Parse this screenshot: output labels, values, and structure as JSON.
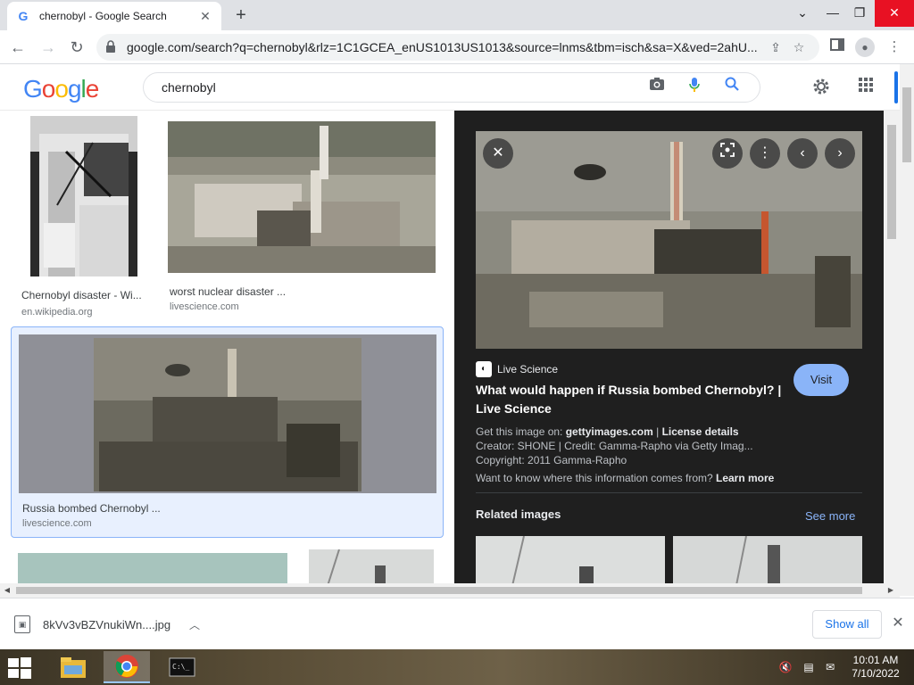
{
  "browser": {
    "tab_title": "chernobyl - Google Search",
    "tab_favicon": "G",
    "url": "google.com/search?q=chernobyl&rlz=1C1GCEA_enUS1013US1013&source=lnms&tbm=isch&sa=X&ved=2ahU..."
  },
  "google": {
    "logo_letters": [
      "G",
      "o",
      "o",
      "g",
      "l",
      "e"
    ],
    "search_query": "chernobyl"
  },
  "results": [
    {
      "title": "Chernobyl disaster - Wi...",
      "source": "en.wikipedia.org"
    },
    {
      "title": "worst nuclear disaster ...",
      "source": "livescience.com"
    },
    {
      "title": "Russia bombed Chernobyl ...",
      "source": "livescience.com"
    }
  ],
  "preview": {
    "source_name": "Live Science",
    "title": "What would happen if Russia bombed Chernobyl? | Live Science",
    "visit_label": "Visit",
    "get_image_prefix": "Get this image on: ",
    "get_image_site": "gettyimages.com",
    "get_image_sep": " | ",
    "license_label": "License details",
    "creator": "Creator: SHONE | Credit: Gamma-Rapho via Getty Imag...",
    "copyright": "Copyright: 2011 Gamma-Rapho",
    "info_question": "Want to know where this information comes from? ",
    "learn_more": "Learn more",
    "related_label": "Related images",
    "see_more_label": "See more"
  },
  "downloads": {
    "file_name": "8kVv3vBZVnukiWn....jpg",
    "show_all_label": "Show all"
  },
  "taskbar": {
    "time": "10:01 AM",
    "date": "7/10/2022"
  },
  "icons": {
    "tab_close": "close-icon",
    "new_tab": "plus-icon",
    "back": "arrow-left-icon",
    "forward": "arrow-right-icon",
    "reload": "reload-icon",
    "lock": "lock-icon",
    "camera": "camera-icon",
    "mic": "mic-icon",
    "search": "search-icon",
    "settings": "gear-icon",
    "apps": "apps-grid-icon"
  },
  "colors": {
    "google_blue": "#4285f4",
    "google_red": "#ea4335",
    "google_yellow": "#fbbc05",
    "google_green": "#34a853",
    "panel_bg": "#1f1f1f",
    "visit_button": "#8ab4f8",
    "link_blue": "#1a73e8"
  }
}
